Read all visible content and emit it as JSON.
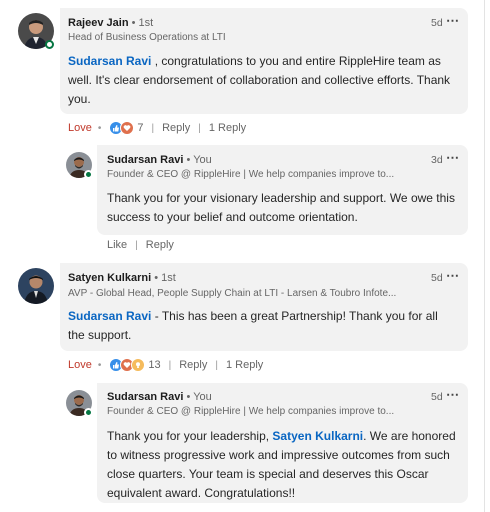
{
  "comments": [
    {
      "author": "Rajeev Jain",
      "degree": "• 1st",
      "headline": "Head of Business Operations at LTI",
      "time": "5d",
      "mention": "Sudarsan Ravi",
      "text": " , congratulations to you and entire RippleHire team as well. It's clear endorsement of collaboration and collective efforts. Thank you.",
      "reaction_label": "Love",
      "reaction_count": "7",
      "reply_label": "Reply",
      "replies_count": "1 Reply",
      "reply": {
        "author": "Sudarsan Ravi",
        "degree": "• You",
        "headline": "Founder & CEO @ RippleHire | We help companies improve to...",
        "time": "3d",
        "text": "Thank you for your visionary leadership and support. We owe this success to your belief and outcome orientation.",
        "like_label": "Like",
        "reply_label": "Reply"
      }
    },
    {
      "author": "Satyen Kulkarni",
      "degree": "• 1st",
      "headline": "AVP - Global Head, People Supply Chain at LTI - Larsen & Toubro Infote...",
      "time": "5d",
      "mention": "Sudarsan Ravi",
      "text": " - This has been a great Partnership! Thank you for all the support.",
      "reaction_label": "Love",
      "reaction_count": "13",
      "reply_label": "Reply",
      "replies_count": "1 Reply",
      "reply": {
        "author": "Sudarsan Ravi",
        "degree": "• You",
        "headline": "Founder & CEO @ RippleHire | We help companies improve to...",
        "time": "5d",
        "text_before": "Thank you for your leadership, ",
        "mention": "Satyen Kulkarni",
        "text_after": ". We are honored to witness progressive work and impressive outcomes from such close quarters. Your team is special and deserves this Oscar equivalent award. Congratulations!!"
      }
    }
  ],
  "more_icon": "⋯",
  "colors": {
    "mention": "#0a66c2",
    "bubble": "#f2f2f2",
    "online": "#057642",
    "love": "#c0392b",
    "like": "#378fe9"
  }
}
